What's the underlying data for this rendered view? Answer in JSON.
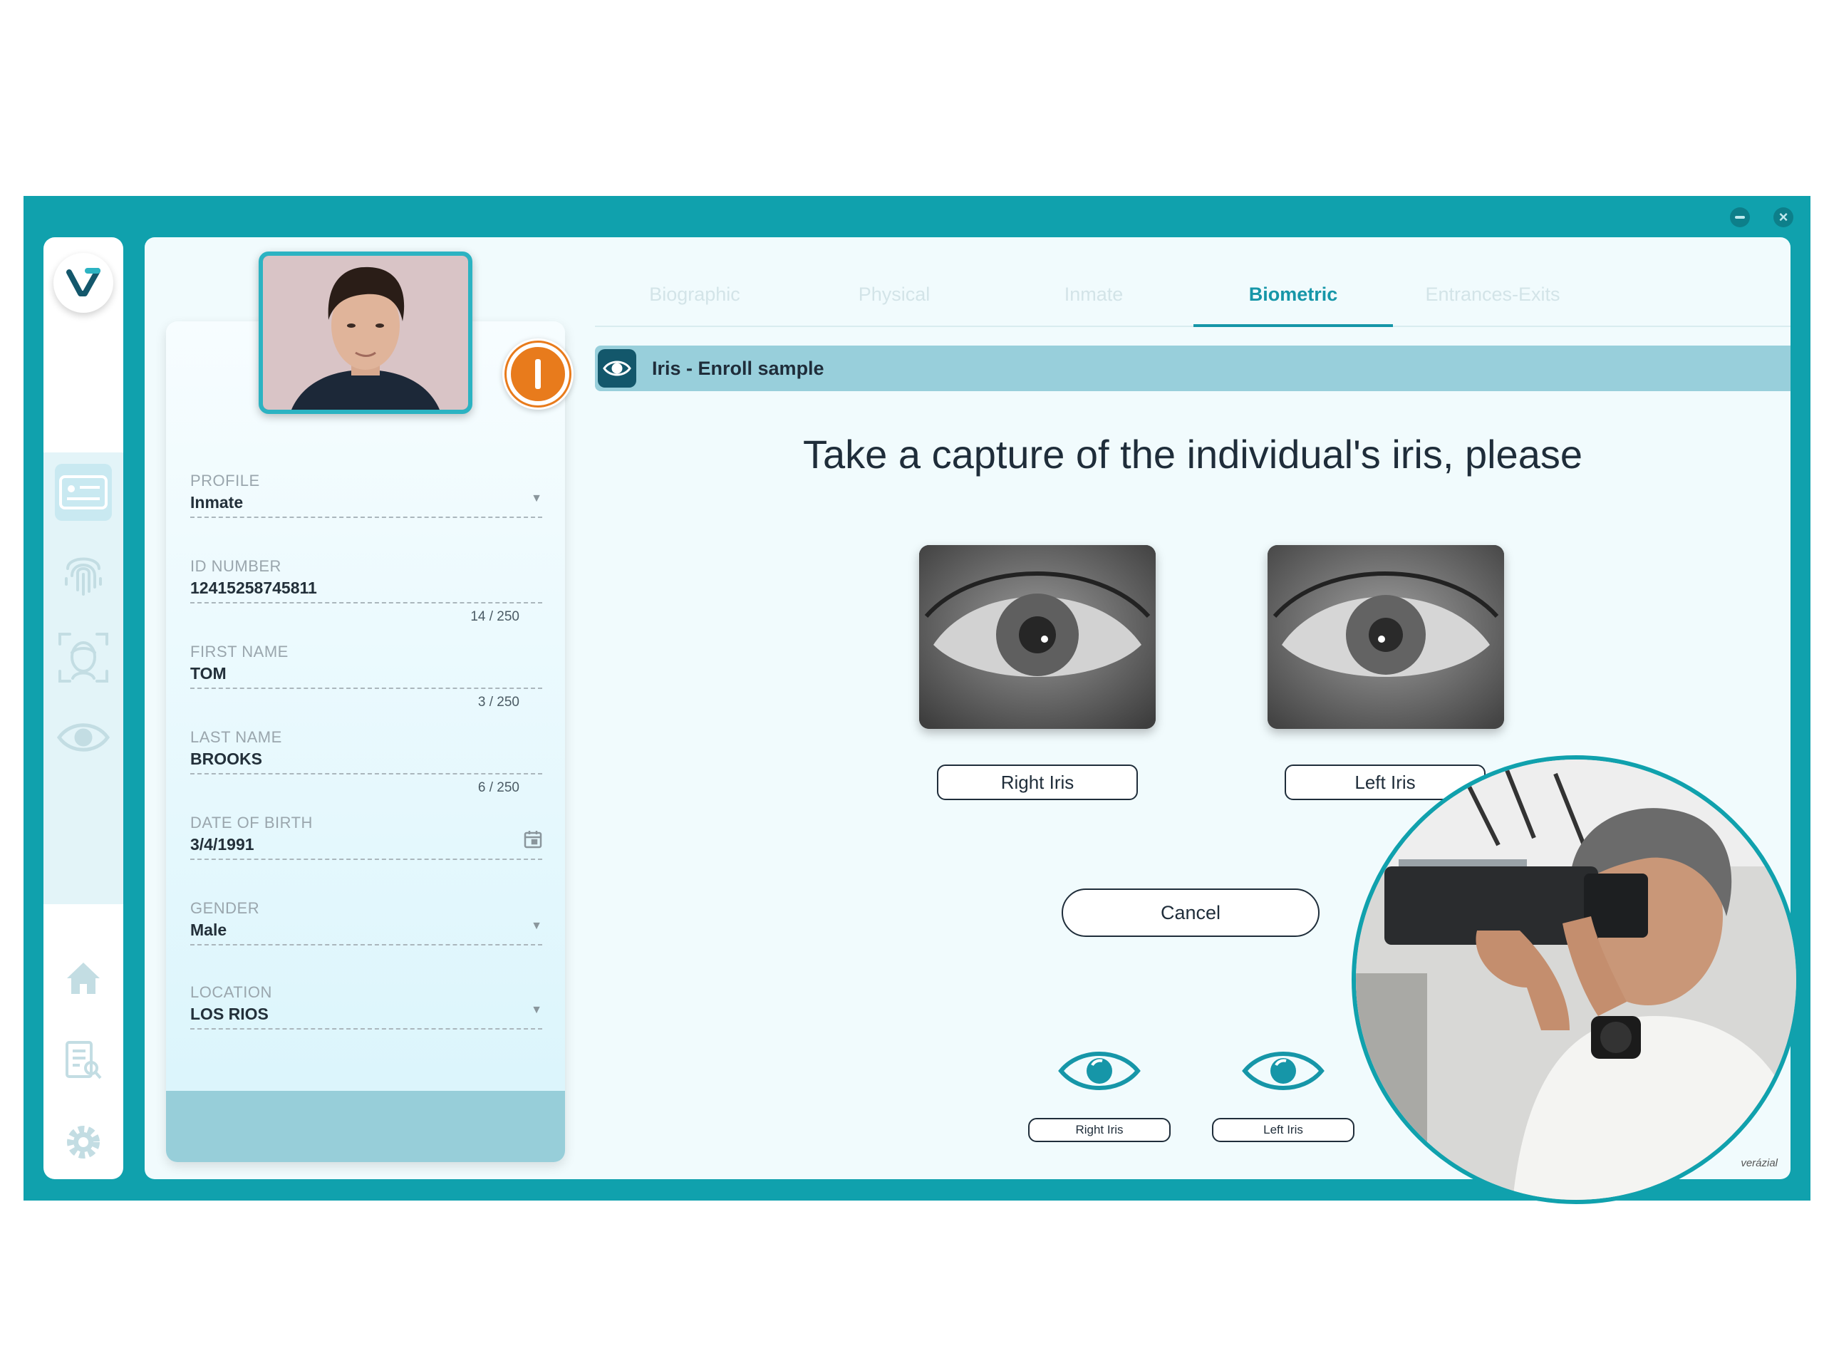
{
  "window": {
    "minimize_icon": "minimize-icon",
    "close_icon": "close-icon",
    "accent_color": "#10a1ad"
  },
  "nav": {
    "items": [
      {
        "name": "id-card-icon",
        "active": true
      },
      {
        "name": "fingerprint-icon",
        "active": false
      },
      {
        "name": "face-scan-icon",
        "active": false
      },
      {
        "name": "eye-icon",
        "active": false
      },
      {
        "name": "home-icon",
        "active": false
      },
      {
        "name": "report-search-icon",
        "active": false
      },
      {
        "name": "gear-icon",
        "active": false
      }
    ]
  },
  "profile": {
    "status_color": "#e87b1c",
    "fields": [
      {
        "label": "PROFILE",
        "value": "Inmate",
        "type": "dropdown"
      },
      {
        "label": "ID NUMBER",
        "value": "12415258745811",
        "counter": "14 / 250"
      },
      {
        "label": "FIRST NAME",
        "value": "TOM",
        "counter": "3 / 250"
      },
      {
        "label": "LAST NAME",
        "value": "BROOKS",
        "counter": "6 / 250"
      },
      {
        "label": "DATE OF BIRTH",
        "value": "3/4/1991",
        "type": "date"
      },
      {
        "label": "GENDER",
        "value": "Male",
        "type": "dropdown"
      },
      {
        "label": "LOCATION",
        "value": "LOS RIOS",
        "type": "dropdown"
      }
    ]
  },
  "tabs": [
    {
      "label": "Biographic",
      "active": false
    },
    {
      "label": "Physical",
      "active": false
    },
    {
      "label": "Inmate",
      "active": false
    },
    {
      "label": "Biometric",
      "active": true
    },
    {
      "label": "Entrances-Exits",
      "active": false
    }
  ],
  "section": {
    "title": "Iris - Enroll sample"
  },
  "capture": {
    "headline": "Take a capture of the individual's iris, please",
    "right_label": "Right Iris",
    "left_label": "Left Iris",
    "cancel_label": "Cancel",
    "small_right_label": "Right Iris",
    "small_left_label": "Left Iris"
  },
  "brand": "verázial"
}
